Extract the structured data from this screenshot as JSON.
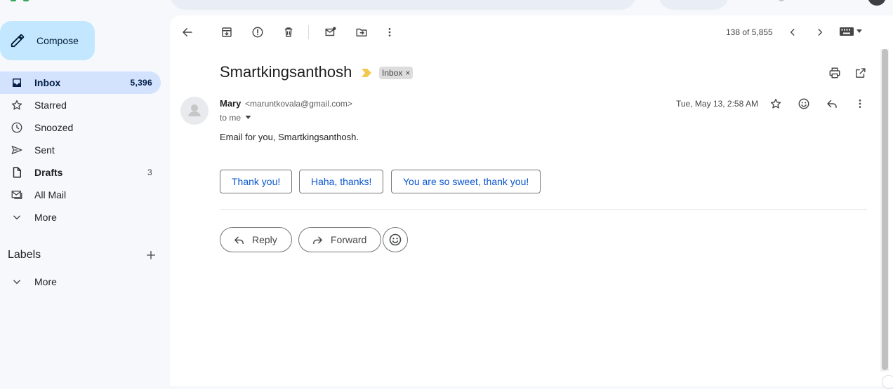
{
  "sidebar": {
    "compose_label": "Compose",
    "items": [
      {
        "label": "Inbox",
        "count": "5,396",
        "icon": "inbox-icon"
      },
      {
        "label": "Starred",
        "count": "",
        "icon": "star-icon"
      },
      {
        "label": "Snoozed",
        "count": "",
        "icon": "clock-icon"
      },
      {
        "label": "Sent",
        "count": "",
        "icon": "send-icon"
      },
      {
        "label": "Drafts",
        "count": "3",
        "icon": "draft-icon"
      },
      {
        "label": "All Mail",
        "count": "",
        "icon": "all-mail-icon"
      },
      {
        "label": "More",
        "count": "",
        "icon": "chevron-down-icon"
      }
    ],
    "labels_title": "Labels",
    "labels_more": "More"
  },
  "toolbar": {
    "pager": "138 of 5,855"
  },
  "email": {
    "subject": "Smartkingsanthosh",
    "label_chip": "Inbox",
    "label_chip_close": "×",
    "sender_name": "Mary",
    "sender_email": "<maruntkovala@gmail.com>",
    "to_line": "to me",
    "date": "Tue, May 13, 2:58 AM",
    "body": "Email for you, Smartkingsanthosh."
  },
  "smart_replies": [
    "Thank you!",
    "Haha, thanks!",
    "You are so sweet, thank you!"
  ],
  "actions": {
    "reply": "Reply",
    "forward": "Forward"
  },
  "colors": {
    "accent": "#0b57d0",
    "compose_bg": "#c2e7ff",
    "active_nav_bg": "#d3e3fd",
    "importance_marker": "#f2c94c",
    "page_bg": "#f6f8fc"
  }
}
